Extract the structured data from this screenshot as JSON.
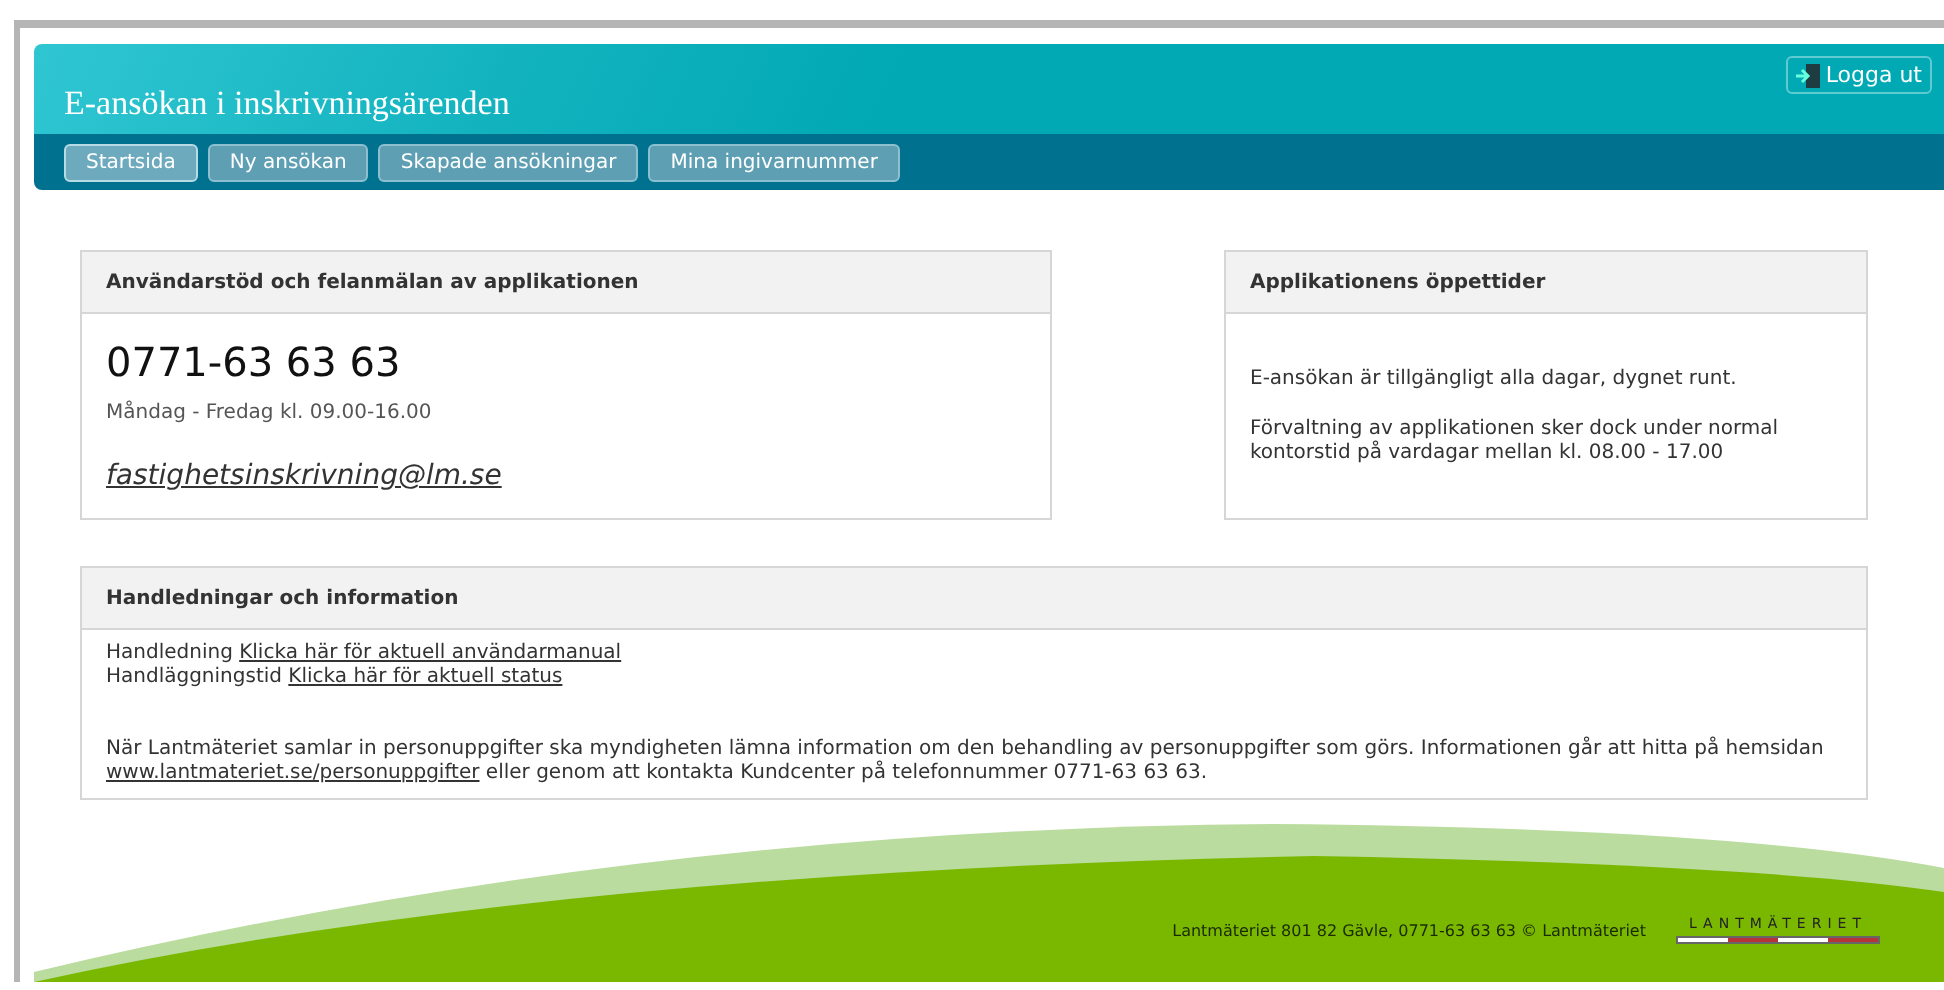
{
  "header": {
    "title": "E-ansökan i inskrivningsärenden",
    "logout": "Logga ut"
  },
  "nav": [
    {
      "label": "Startsida",
      "selected": true
    },
    {
      "label": "Ny ansökan",
      "selected": false
    },
    {
      "label": "Skapade ansökningar",
      "selected": false
    },
    {
      "label": "Mina ingivarnummer",
      "selected": false
    }
  ],
  "support_card": {
    "title": "Användarstöd och felanmälan av applikationen",
    "phone": "0771-63 63 63",
    "hours": "Måndag - Fredag kl. 09.00-16.00",
    "email": "fastighetsinskrivning@lm.se"
  },
  "hours_card": {
    "title": "Applikationens öppettider",
    "paragraphs": [
      "E-ansökan är tillgängligt alla dagar, dygnet runt.",
      "Förvaltning av applikationen sker dock under normal kontorstid på vardagar mellan kl. 08.00 - 17.00"
    ]
  },
  "info_card": {
    "title": "Handledningar och information",
    "guides": [
      {
        "label": "Handledning",
        "link": "Klicka här för aktuell användarmanual"
      },
      {
        "label": "Handläggningstid",
        "link": "Klicka här för aktuell status"
      }
    ],
    "notice": {
      "text": "När Lantmäteriet samlar in personuppgifter ska myndigheten lämna information om den behandling av personuppgifter som görs. Informationen går att hitta på hemsidan",
      "link": "www.lantmateriet.se/personuppgifter",
      "after": "eller genom att kontakta Kundcenter på telefonnummer 0771-63 63 63."
    }
  },
  "footer": {
    "text": "Lantmäteriet 801 82 Gävle, 0771-63 63 63 © Lantmäteriet",
    "logo": "LANTMÄTERIET"
  }
}
